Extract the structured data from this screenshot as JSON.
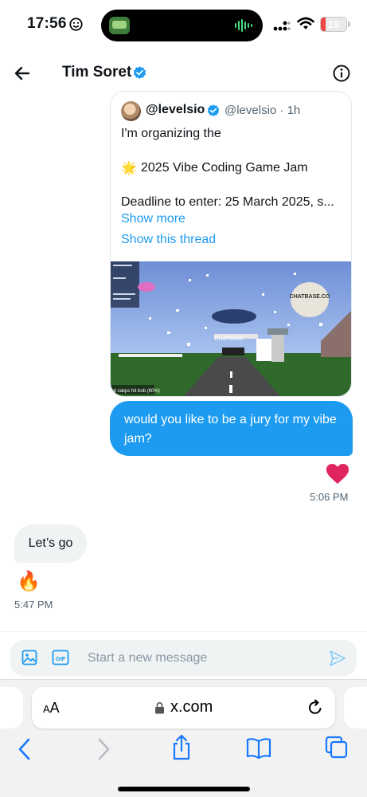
{
  "status_bar": {
    "time": "17:56",
    "battery": "19",
    "battery_level": 0.19
  },
  "header": {
    "contact_name": "Tim Soret",
    "back_icon": "arrow-left-icon",
    "info_icon": "info-icon"
  },
  "quote": {
    "author_name": "@levelsio",
    "author_handle": "@levelsio · 1h",
    "line1": "I'm organizing the",
    "star": "🌟",
    "line2": "2025 Vibe Coding Game Jam",
    "line3": "Deadline to enter: 25 March 2025, s...",
    "show_more": "Show more",
    "show_thread": "Show this thread",
    "image": {
      "billboard": "CHATBASE.CO",
      "billboard2": "CHATBASE",
      "hud_caption": "at zakpc hit bob (60%)"
    }
  },
  "messages": {
    "outgoing_text": "would you like to be a jury for my vibe jam?",
    "outgoing_time": "5:06 PM",
    "incoming_text": "Let’s go",
    "reaction": "🔥",
    "incoming_time": "5:47 PM"
  },
  "composer": {
    "placeholder": "Start a new message"
  },
  "browser": {
    "aa_small": "A",
    "aa_large": "A",
    "url": "x.com"
  },
  "colors": {
    "accent": "#1d9bf0",
    "heart": "#e0245e",
    "battery": "#ef4444"
  }
}
